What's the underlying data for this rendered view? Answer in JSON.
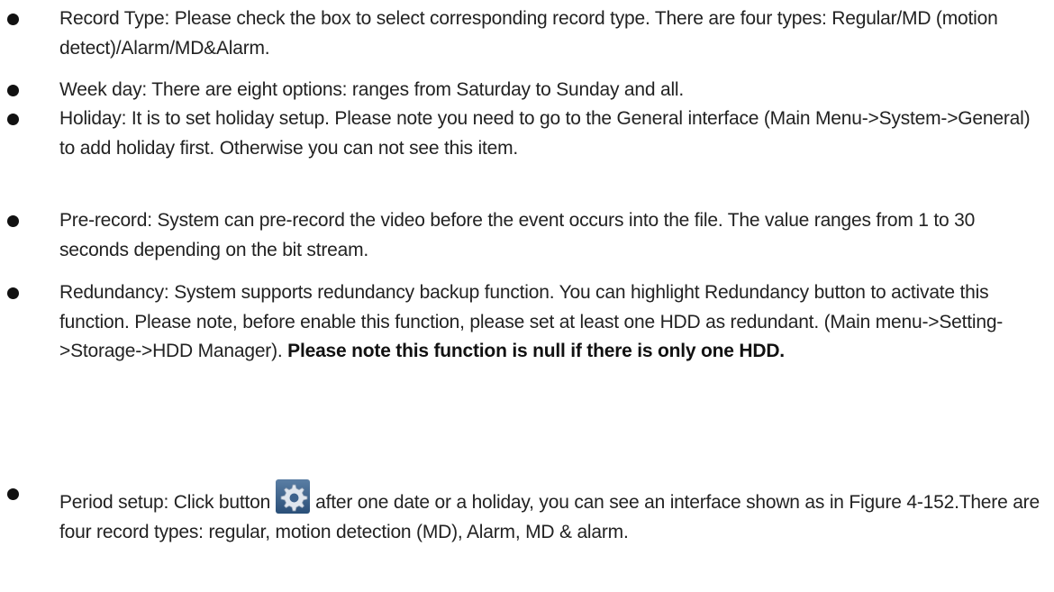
{
  "items": [
    {
      "text": "Record Type: Please check the box to select corresponding record type. There are four types: Regular/MD (motion detect)/Alarm/MD&Alarm."
    },
    {
      "text": "Week day: There are eight options: ranges from Saturday to Sunday and all."
    },
    {
      "text": "Holiday: It is to set holiday setup. Please note you need to go to the General interface (Main Menu->System->General) to add holiday first. Otherwise you can not see this item."
    },
    {
      "text": "Pre-record: System can pre-record the video before the event occurs into the file. The value ranges from 1 to 30 seconds depending on the bit stream."
    },
    {
      "text": "Redundancy: System supports redundancy backup function.    You can highlight Redundancy button to activate this function. Please note, before enable this function, please set at least one HDD as redundant. (Main menu->Setting->Storage->HDD Manager). ",
      "bold": "Please note this function is null if there is only one HDD."
    },
    {
      "text_before": "Period setup: Click button",
      "text_after": "after one date or a holiday, you can see an interface shown as in Figure 4-152.There are four record types: regular, motion detection (MD), Alarm, MD & alarm.",
      "icon": "gear-icon"
    }
  ]
}
